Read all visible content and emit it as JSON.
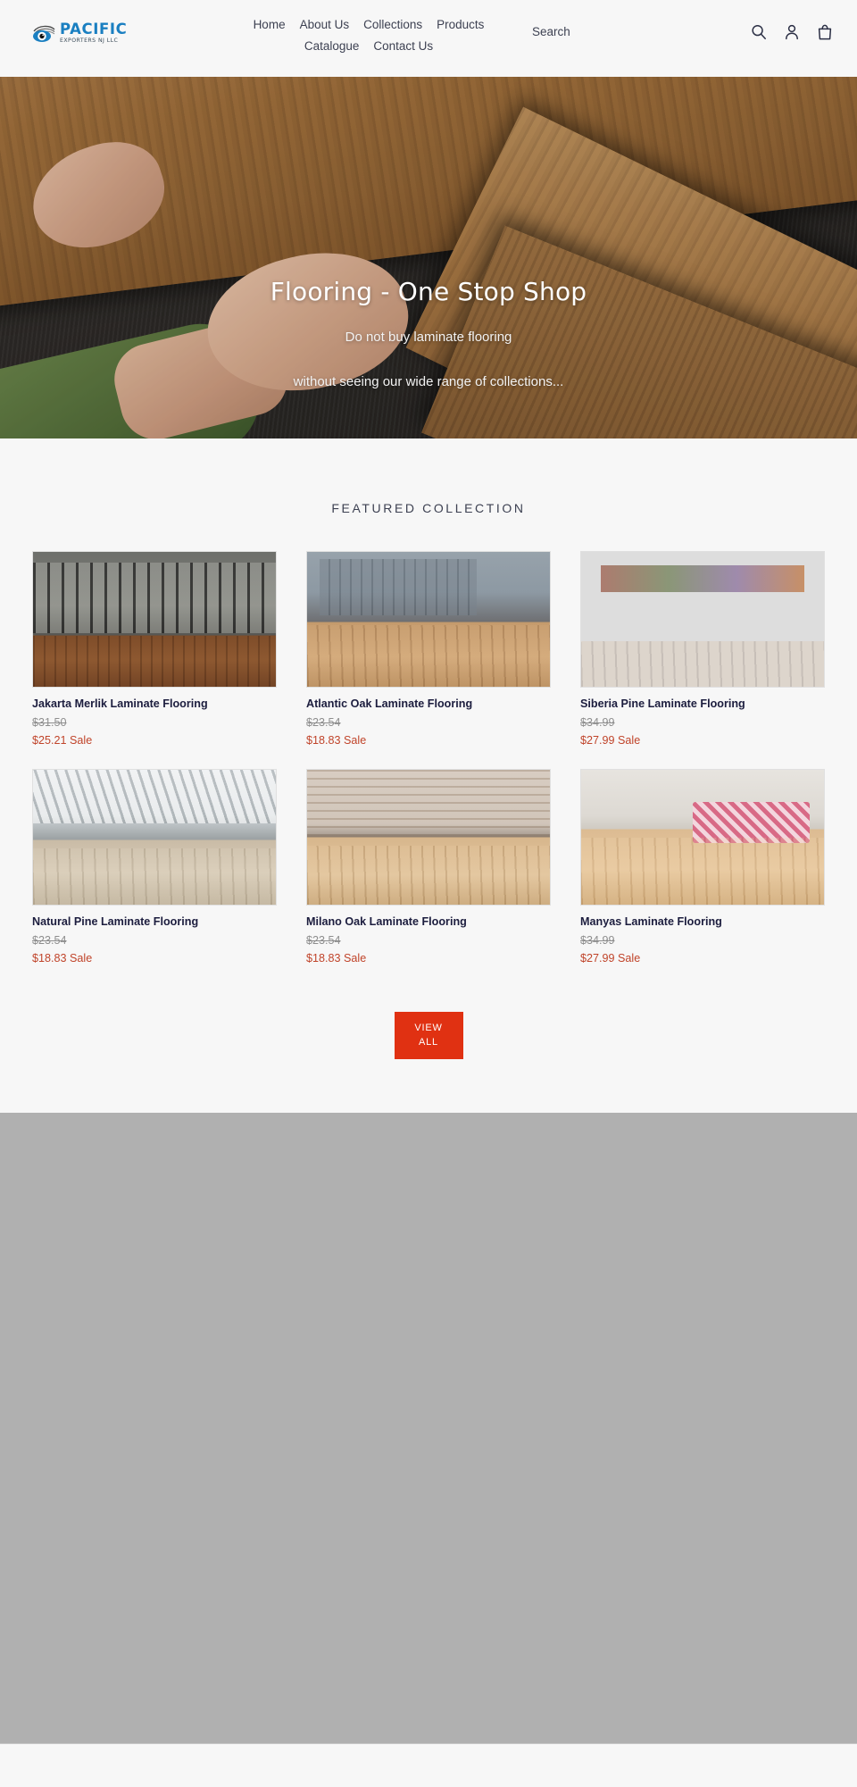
{
  "header": {
    "logo": {
      "icon": "eye-logo-icon",
      "main_text": "PACIFIC",
      "sub_text": "EXPORTERS NJ LLC"
    },
    "nav": [
      {
        "label": "Home"
      },
      {
        "label": "About Us"
      },
      {
        "label": "Collections"
      },
      {
        "label": "Products"
      },
      {
        "label": "Catalogue"
      },
      {
        "label": "Contact Us"
      }
    ],
    "search_label": "Search",
    "icons": [
      {
        "name": "search-icon"
      },
      {
        "name": "account-icon"
      },
      {
        "name": "cart-icon"
      }
    ]
  },
  "hero": {
    "title": "Flooring - One Stop Shop",
    "subtitle_line1": "Do not buy laminate flooring",
    "subtitle_line2": "without seeing our wide range of collections..."
  },
  "featured": {
    "section_title": "FEATURED COLLECTION",
    "sale_word": "Sale",
    "products": [
      {
        "title": "Jakarta Merlik Laminate Flooring",
        "price_regular": "$31.50",
        "price_sale": "$25.21 Sale",
        "thumb_class": "ph-lobby",
        "thumb_name": "product-image-jakarta-merlik"
      },
      {
        "title": "Atlantic Oak Laminate Flooring",
        "price_regular": "$23.54",
        "price_sale": "$18.83 Sale",
        "thumb_class": "ph-loft",
        "thumb_name": "product-image-atlantic-oak"
      },
      {
        "title": "Siberia Pine Laminate Flooring",
        "price_regular": "$34.99",
        "price_sale": "$27.99 Sale",
        "thumb_class": "ph-bedroom-dark",
        "thumb_name": "product-image-siberia-pine"
      },
      {
        "title": "Natural Pine Laminate Flooring",
        "price_regular": "$23.54",
        "price_sale": "$18.83 Sale",
        "thumb_class": "ph-attic",
        "thumb_name": "product-image-natural-pine"
      },
      {
        "title": "Milano Oak Laminate Flooring",
        "price_regular": "$23.54",
        "price_sale": "$18.83 Sale",
        "thumb_class": "ph-brick",
        "thumb_name": "product-image-milano-oak"
      },
      {
        "title": "Manyas Laminate Flooring",
        "price_regular": "$34.99",
        "price_sale": "$27.99 Sale",
        "thumb_class": "ph-kids",
        "thumb_name": "product-image-manyas"
      }
    ],
    "view_all_line1": "VIEW",
    "view_all_line2": "ALL"
  },
  "colors": {
    "accent_button": "#e03112",
    "sale_price": "#c0442a",
    "logo_blue": "#1a7fc1",
    "page_background": "#f7f7f7",
    "gray_block": "#b0b0b0"
  }
}
